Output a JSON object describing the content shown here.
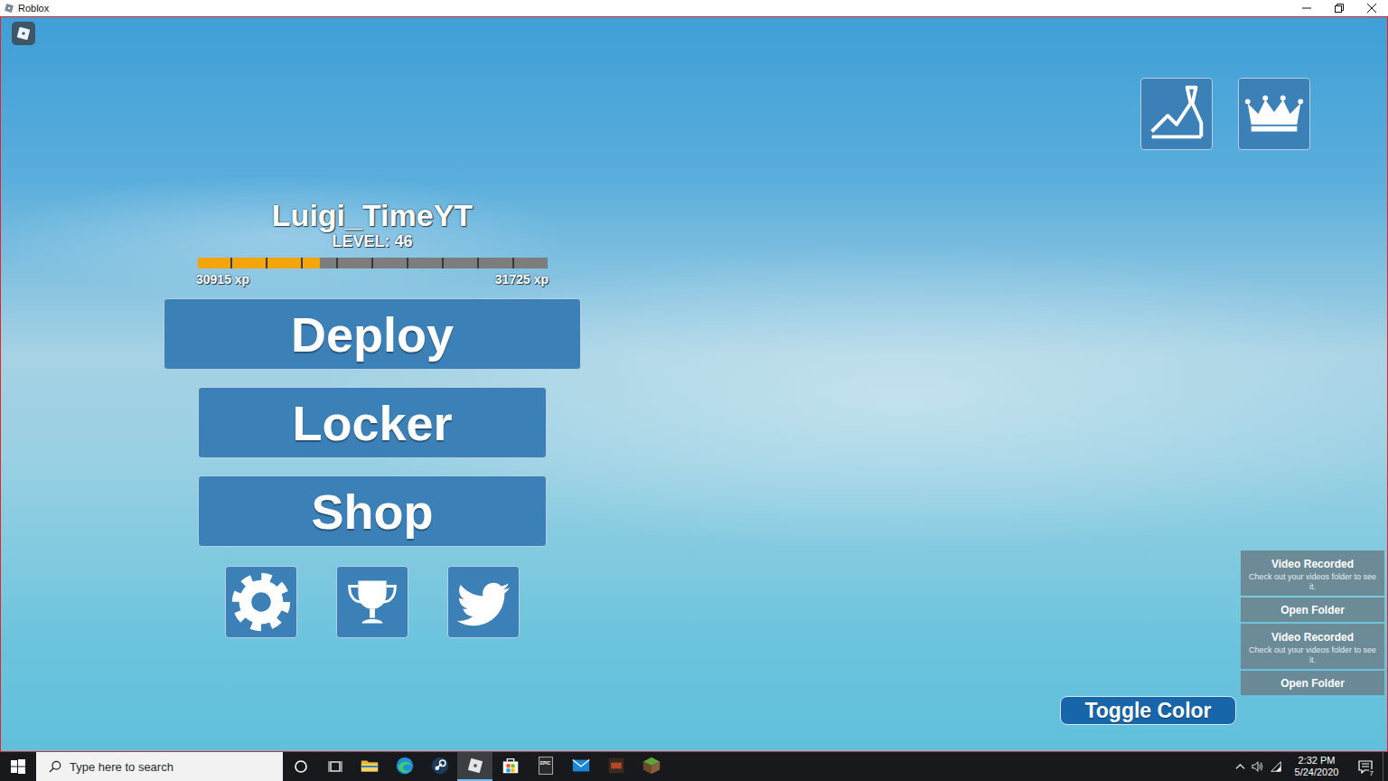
{
  "window": {
    "title": "Roblox"
  },
  "player": {
    "name": "Luigi_TimeYT",
    "level": "LEVEL: 46",
    "xp": {
      "current": "30915 xp",
      "next": "31725 xp",
      "level": 0.35
    }
  },
  "top_buttons": [
    {
      "kind": "stats"
    },
    {
      "kind": "crown"
    }
  ],
  "menu": [
    {
      "label": "Deploy",
      "kind": "wide"
    },
    {
      "label": "Locker",
      "kind": "normal"
    },
    {
      "label": "Shop",
      "kind": "normal"
    }
  ],
  "icon_buttons": [
    {
      "kind": "settings"
    },
    {
      "kind": "trophy"
    },
    {
      "kind": "twitter"
    }
  ],
  "toggle": {
    "label": "Toggle Color"
  },
  "notifications": [
    {
      "title": "Video Recorded",
      "message": "Check out your videos folder to see it.",
      "action": "Open Folder"
    },
    {
      "title": "Video Recorded",
      "message": "Check out your videos folder to see it.",
      "action": "Open Folder"
    }
  ],
  "taskbar": {
    "search": {
      "placeholder": "Type here to search"
    },
    "apps": [
      {
        "kind": "explorer",
        "selected": false
      },
      {
        "kind": "edge",
        "selected": false
      },
      {
        "kind": "steam",
        "selected": false
      },
      {
        "kind": "roblox",
        "selected": true
      },
      {
        "kind": "store",
        "selected": false
      },
      {
        "kind": "epic",
        "selected": false,
        "label": "EPIC"
      },
      {
        "kind": "mail",
        "selected": false
      },
      {
        "kind": "dungeons",
        "selected": false
      },
      {
        "kind": "minecraft",
        "selected": false
      }
    ],
    "clock": {
      "time": "2:32 PM",
      "date": "5/24/2020"
    },
    "notification_count": "7"
  }
}
